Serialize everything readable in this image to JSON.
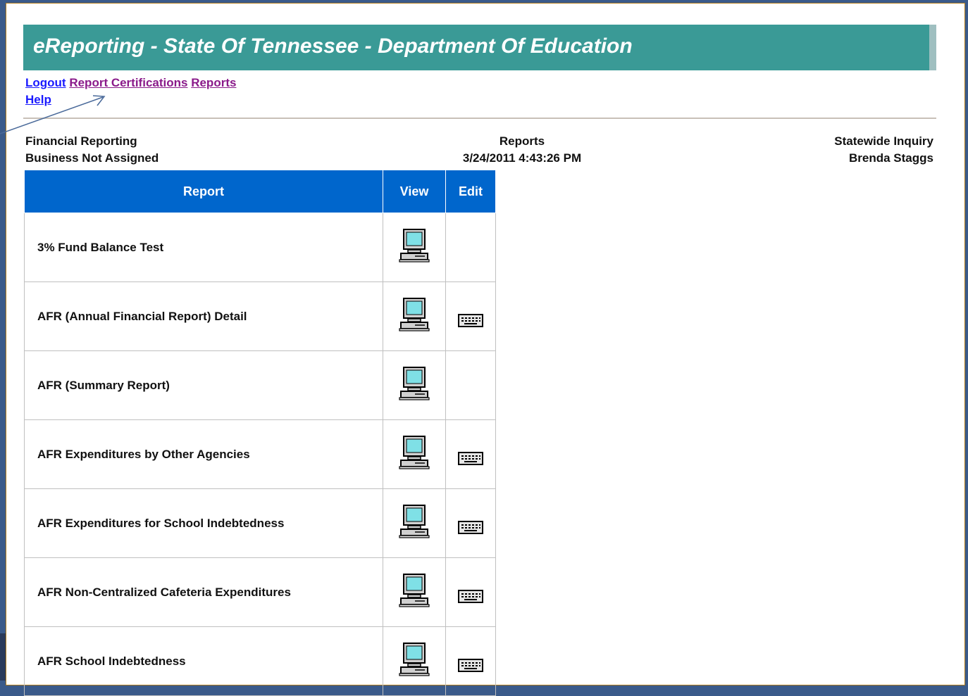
{
  "title": "eReporting - State Of Tennessee - Department Of Education",
  "nav": {
    "logout": "Logout",
    "report_certifications": "Report Certifications",
    "reports": "Reports",
    "help": "Help"
  },
  "header": {
    "left_line1": "Financial Reporting",
    "left_line2": "Business Not Assigned",
    "center_line1": "Reports",
    "center_line2": "3/24/2011 4:43:26 PM",
    "right_line1": "Statewide Inquiry",
    "right_line2": "Brenda Staggs"
  },
  "table": {
    "columns": [
      "Report",
      "View",
      "Edit"
    ],
    "rows": [
      {
        "name": "3% Fund Balance Test",
        "view_icon": "computer-icon",
        "edit_icon": null
      },
      {
        "name": "AFR (Annual Financial Report) Detail",
        "view_icon": "computer-icon",
        "edit_icon": "keyboard-icon"
      },
      {
        "name": "AFR (Summary Report)",
        "view_icon": "computer-icon",
        "edit_icon": null
      },
      {
        "name": "AFR Expenditures by Other Agencies",
        "view_icon": "computer-icon",
        "edit_icon": "keyboard-icon"
      },
      {
        "name": "AFR Expenditures for School Indebtedness",
        "view_icon": "computer-icon",
        "edit_icon": "keyboard-icon"
      },
      {
        "name": "AFR Non-Centralized Cafeteria Expenditures",
        "view_icon": "computer-icon",
        "edit_icon": "keyboard-icon"
      },
      {
        "name": "AFR School Indebtedness",
        "view_icon": "computer-icon",
        "edit_icon": "keyboard-icon"
      }
    ]
  },
  "colors": {
    "title_bar": "#3a9a96",
    "table_header": "#0066cc",
    "link_blue": "#1a1aff",
    "link_visited": "#8a1a8a"
  }
}
